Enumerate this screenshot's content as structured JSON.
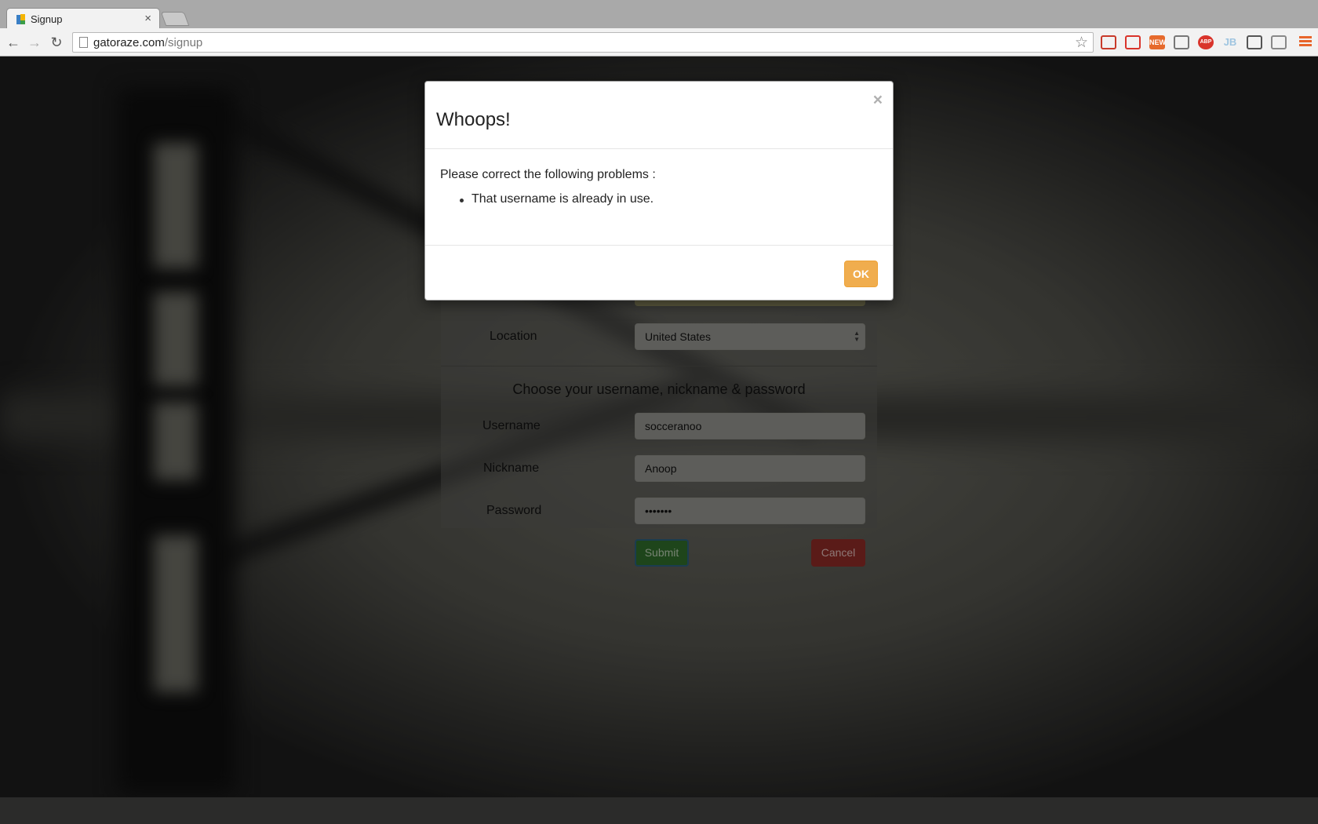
{
  "browser": {
    "tab_title": "Signup",
    "tab_close": "×",
    "url_domain": "gatoraze.com",
    "url_path": "/signup",
    "extensions": [
      {
        "name": "bookmark-extension-icon",
        "label": "",
        "color": "#c83a2a"
      },
      {
        "name": "record-extension-icon",
        "label": "",
        "color": "#d9342b"
      },
      {
        "name": "new-extension-icon",
        "label": "NEW",
        "color": "#e66a2c"
      },
      {
        "name": "cast-icon",
        "label": "",
        "color": "#777777"
      },
      {
        "name": "adblock-icon",
        "label": "ABP",
        "color": "#d9342b"
      },
      {
        "name": "jb-extension-icon",
        "label": "JB",
        "color": "#9ec4e0"
      },
      {
        "name": "eyedropper-extension-icon",
        "label": "",
        "color": "#555555"
      },
      {
        "name": "audio-extension-icon",
        "label": "",
        "color": "#888888"
      }
    ]
  },
  "form": {
    "location_label": "Location",
    "location_value": "United States",
    "section_title": "Choose your username, nickname & password",
    "username_label": "Username",
    "username_value": "socceranoo",
    "nickname_label": "Nickname",
    "nickname_value": "Anoop",
    "password_label": "Password",
    "password_value": "•••••••",
    "submit_label": "Submit",
    "cancel_label": "Cancel"
  },
  "modal": {
    "title": "Whoops!",
    "close": "×",
    "intro": "Please correct the following problems :",
    "errors": [
      "That username is already in use."
    ],
    "ok_label": "OK"
  },
  "colors": {
    "ok_button": "#f0ad4e",
    "submit_button": "#2f6a2a",
    "cancel_button": "#8a2a26"
  }
}
